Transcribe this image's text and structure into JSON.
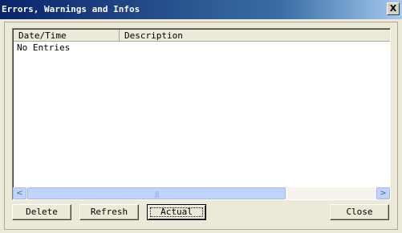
{
  "window": {
    "title": "Errors, Warnings and Infos",
    "close_glyph": "X"
  },
  "list": {
    "columns": [
      "Date/Time",
      "Description"
    ],
    "rows": [],
    "empty_text": "No Entries"
  },
  "scrollbar": {
    "left_glyph": "<",
    "right_glyph": ">",
    "grip_glyph": "|||"
  },
  "buttons": {
    "delete": "Delete",
    "refresh": "Refresh",
    "actual": "Actual",
    "close": "Close"
  }
}
